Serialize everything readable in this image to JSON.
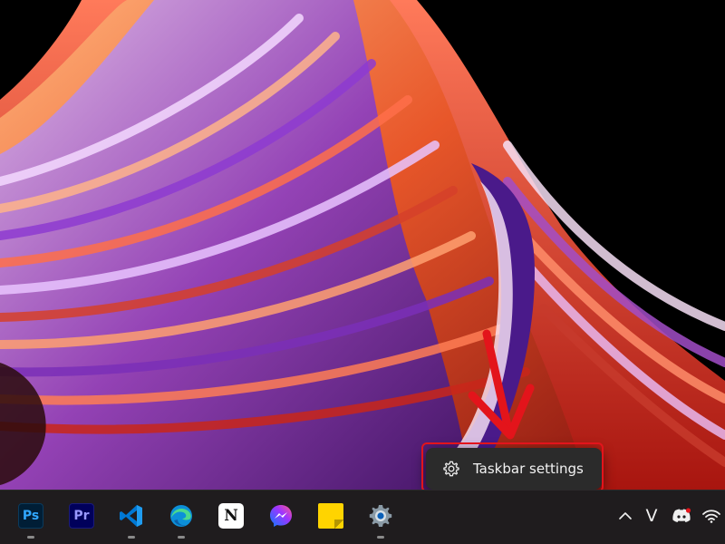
{
  "context_menu": {
    "item_label": "Taskbar settings",
    "item_icon": "gear-icon",
    "highlight_color": "#e3141b"
  },
  "taskbar": {
    "background": "#1f1c1e",
    "apps": [
      {
        "name": "photoshop",
        "label": "Ps",
        "running": true
      },
      {
        "name": "premiere-pro",
        "label": "Pr",
        "running": false
      },
      {
        "name": "visual-studio-code",
        "running": true
      },
      {
        "name": "microsoft-edge",
        "running": true
      },
      {
        "name": "notion",
        "label": "N",
        "running": false
      },
      {
        "name": "messenger",
        "running": false
      },
      {
        "name": "sticky-notes",
        "running": false
      },
      {
        "name": "settings",
        "running": true
      }
    ],
    "tray": {
      "overflow_icon": "chevron-up-icon",
      "v_label": "V",
      "discord_icon": "discord-icon",
      "wifi_icon": "wifi-icon"
    }
  }
}
